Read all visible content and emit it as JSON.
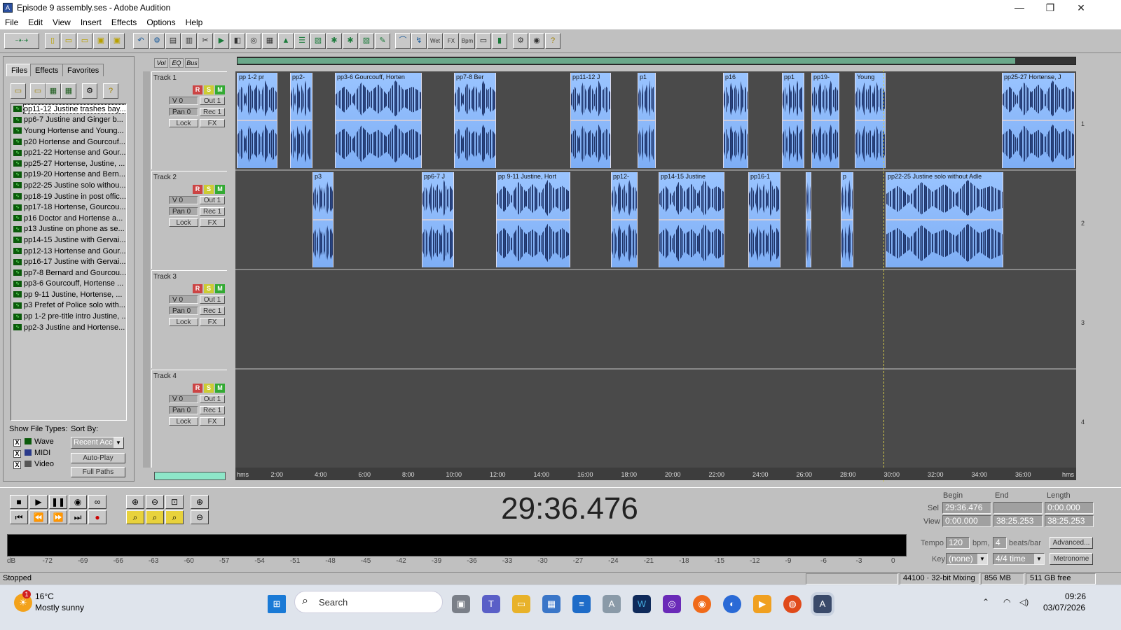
{
  "window": {
    "title": "Episode 9 assembly.ses - Adobe Audition",
    "minimize": "—",
    "maximize": "❐",
    "close": "✕"
  },
  "menu": [
    "File",
    "Edit",
    "View",
    "Insert",
    "Effects",
    "Options",
    "Help"
  ],
  "left_panel": {
    "tabs": [
      "Files",
      "Effects",
      "Favorites"
    ],
    "files": [
      "pp11-12 Justine trashes bay...",
      "pp6-7 Justine and Ginger b...",
      "Young Hortense and Young...",
      "p20 Hortense and Gourcouf...",
      "pp21-22 Hortense and Gour...",
      "pp25-27 Hortense, Justine, ...",
      "pp19-20 Hortense and Bern...",
      "pp22-25 Justine solo withou...",
      "pp18-19 Justine in post offic...",
      "pp17-18 Hortense, Gourcou...",
      "p16 Doctor and Hortense  a...",
      "p13 Justine on phone as se...",
      "pp14-15 Justine with Gervai...",
      "pp12-13 Hortense and Gour...",
      "pp16-17 Justine with Gervai...",
      "pp7-8 Bernard and Gourcou...",
      "pp3-6 Gourcouff, Hortense ...",
      "pp 9-11 Justine, Hortense, ...",
      "p3 Prefet of Police solo with...",
      "pp 1-2 pre-title intro Justine, ...",
      "pp2-3 Justine and Hortense..."
    ],
    "show_file_types_label": "Show File Types:",
    "sort_by_label": "Sort By:",
    "types": [
      "Wave",
      "MIDI",
      "Video"
    ],
    "sort_value": "Recent Acc",
    "auto_play": "Auto-Play",
    "full_paths": "Full Paths"
  },
  "track_header": {
    "tabs": [
      "Vol",
      "EQ",
      "Bus"
    ],
    "tracks": [
      {
        "name": "Track 1",
        "vol": "V 0",
        "pan": "Pan 0",
        "out": "Out 1",
        "rec": "Rec 1",
        "lock": "Lock",
        "fx": "FX",
        "num": "1"
      },
      {
        "name": "Track 2",
        "vol": "V 0",
        "pan": "Pan 0",
        "out": "Out 1",
        "rec": "Rec 1",
        "lock": "Lock",
        "fx": "FX",
        "num": "2"
      },
      {
        "name": "Track 3",
        "vol": "V 0",
        "pan": "Pan 0",
        "out": "Out 1",
        "rec": "Rec 1",
        "lock": "Lock",
        "fx": "FX",
        "num": "3"
      },
      {
        "name": "Track 4",
        "vol": "V 0",
        "pan": "Pan 0",
        "out": "Out 1",
        "rec": "Rec 1",
        "lock": "Lock",
        "fx": "FX",
        "num": "4"
      }
    ],
    "rsm": [
      "R",
      "S",
      "M"
    ]
  },
  "clips_track1": [
    "pp 1-2 pr",
    "pp2-",
    "pp3-6 Gourcouff, Horten",
    "pp7-8 Ber",
    "pp11-12 J",
    "p1",
    "p16",
    "pp1",
    "pp19-",
    "Young",
    "pp25-27 Hortense, J"
  ],
  "clips_track2": [
    "p3",
    "pp6-7 J",
    "pp 9-11 Justine, Hort",
    "pp12-",
    "pp14-15 Justine",
    "pp16-1",
    "",
    "p",
    "pp22-25 Justine solo without Adle"
  ],
  "ruler": [
    "hms",
    "2:00",
    "4:00",
    "6:00",
    "8:00",
    "10:00",
    "12:00",
    "14:00",
    "16:00",
    "18:00",
    "20:00",
    "22:00",
    "24:00",
    "26:00",
    "28:00",
    "30:00",
    "32:00",
    "34:00",
    "36:00",
    "hms"
  ],
  "transport": {
    "time": "29:36.476"
  },
  "selection": {
    "headers": [
      "Begin",
      "End",
      "Length"
    ],
    "sel_label": "Sel",
    "view_label": "View",
    "sel": [
      "29:36.476",
      "",
      "0:00.000"
    ],
    "view": [
      "0:00.000",
      "38:25.253",
      "38:25.253"
    ]
  },
  "tempo": {
    "tempo_label": "Tempo",
    "tempo": "120",
    "bpm": "bpm,",
    "beats": "4",
    "beats_label": "beats/bar",
    "advanced": "Advanced...",
    "key_label": "Key",
    "key": "(none)",
    "time_sig": "4/4 time",
    "metronome": "Metronome"
  },
  "meter_scale": [
    "dB",
    "-72",
    "-69",
    "-66",
    "-63",
    "-60",
    "-57",
    "-54",
    "-51",
    "-48",
    "-45",
    "-42",
    "-39",
    "-36",
    "-33",
    "-30",
    "-27",
    "-24",
    "-21",
    "-18",
    "-15",
    "-12",
    "-9",
    "-6",
    "-3",
    "0"
  ],
  "status": {
    "state": "Stopped",
    "format": "44100 · 32-bit Mixing",
    "mem": "856 MB",
    "disk": "511 GB free"
  },
  "taskbar": {
    "temp": "16°C",
    "weather": "Mostly sunny",
    "search": "Search",
    "time": "09:26",
    "date": "03/07/2026",
    "badge": "1"
  }
}
